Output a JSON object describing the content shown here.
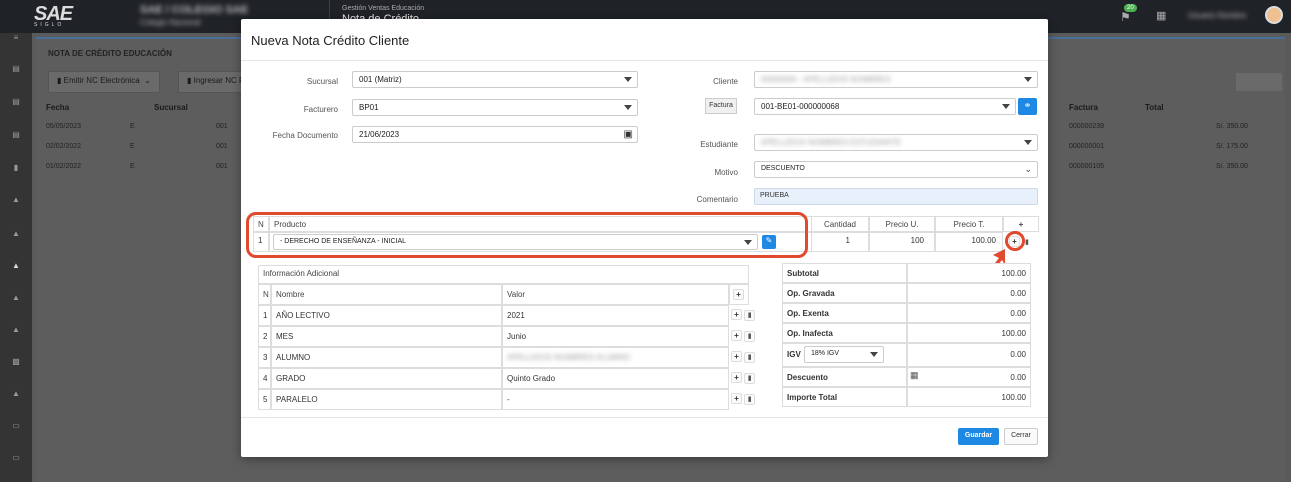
{
  "topbar": {
    "logo": "SAE",
    "logo_sub": "SIGLO",
    "company_line1": "SAE / COLEGIO SAE",
    "company_line2": "Colegio Nacional",
    "module_title": "Gestión Ventas Educación",
    "module_subtitle": "Nota de Crédito",
    "notif_count": "20",
    "user_name": "Usuario Nombre"
  },
  "background": {
    "title": "NOTA DE CRÉDITO EDUCACIÓN",
    "toolbar": {
      "emit_label": "Emitir NC Electrónica",
      "ingresar_label": "Ingresar NC F"
    },
    "columns": {
      "fecha": "Fecha",
      "sucursal": "Sucursal",
      "factura": "Factura",
      "total": "Total"
    },
    "rows": [
      {
        "fecha": "05/05/2023",
        "tipo": "E",
        "sucursal": "001",
        "factura": "000000239",
        "total": "S/. 350.00"
      },
      {
        "fecha": "02/02/2022",
        "tipo": "E",
        "sucursal": "001",
        "factura": "000000001",
        "total": "S/. 175.00"
      },
      {
        "fecha": "01/02/2022",
        "tipo": "E",
        "sucursal": "001",
        "factura": "000000105",
        "total": "S/. 350.00"
      }
    ]
  },
  "modal": {
    "title": "Nueva Nota Crédito Cliente",
    "sucursal": {
      "label": "Sucursal",
      "value": "001 (Matriz)"
    },
    "facturero": {
      "label": "Facturero",
      "value": "BP01"
    },
    "fecha_documento": {
      "label": "Fecha Documento",
      "value": "21/06/2023"
    },
    "cliente": {
      "label": "Cliente",
      "value": "00000000 - APELLIDOS NOMBRES"
    },
    "factura": {
      "label": "Factura",
      "value": "001-BE01-000000068"
    },
    "estudiante": {
      "label": "Estudiante",
      "value": "APELLIDOS NOMBRES ESTUDIANTE"
    },
    "motivo": {
      "label": "Motivo",
      "value": "DESCUENTO"
    },
    "comentario": {
      "label": "Comentario",
      "value": "PRUEBA"
    },
    "product_table": {
      "headers": {
        "n": "N",
        "producto": "Producto",
        "cantidad": "Cantidad",
        "precio_u": "Precio U.",
        "precio_t": "Precio T.",
        "add": "+"
      },
      "rows": [
        {
          "n": "1",
          "producto": "- DERECHO DE ENSEÑANZA - INICIAL",
          "cantidad": "1",
          "precio_u": "100",
          "precio_t": "100.00"
        }
      ]
    },
    "info_adicional": {
      "title": "Información Adicional",
      "headers": {
        "n": "N",
        "nombre": "Nombre",
        "valor": "Valor"
      },
      "rows": [
        {
          "n": "1",
          "nombre": "AÑO LECTIVO",
          "valor": "2021"
        },
        {
          "n": "2",
          "nombre": "MES",
          "valor": "Junio"
        },
        {
          "n": "3",
          "nombre": "ALUMNO",
          "valor": "APELLIDOS NOMBRES ALUMNO"
        },
        {
          "n": "4",
          "nombre": "GRADO",
          "valor": "Quinto Grado"
        },
        {
          "n": "5",
          "nombre": "PARALELO",
          "valor": "-"
        }
      ]
    },
    "totals": {
      "subtotal": {
        "label": "Subtotal",
        "value": "100.00"
      },
      "op_gravada": {
        "label": "Op. Gravada",
        "value": "0.00"
      },
      "op_exenta": {
        "label": "Op. Exenta",
        "value": "0.00"
      },
      "op_inafecta": {
        "label": "Op. Inafecta",
        "value": "100.00"
      },
      "igv": {
        "label": "IGV",
        "select": "18% IGV",
        "value": "0.00"
      },
      "descuento": {
        "label": "Descuento",
        "value": "0.00"
      },
      "importe_total": {
        "label": "Importe Total",
        "value": "100.00"
      }
    },
    "buttons": {
      "save": "Guardar",
      "close": "Cerrar"
    }
  },
  "colors": {
    "accent": "#1e88e5",
    "highlight": "#e04a2f",
    "comment_bg": "#e8f0fb"
  }
}
